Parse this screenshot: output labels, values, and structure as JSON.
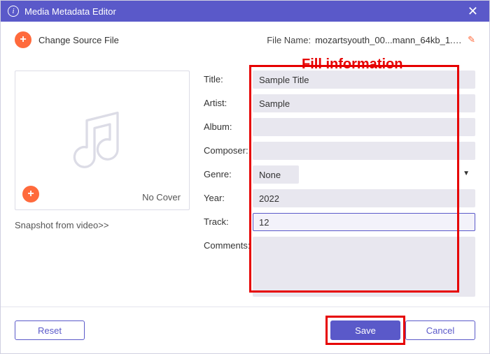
{
  "window": {
    "title": "Media Metadata Editor"
  },
  "toolbar": {
    "change_source": "Change Source File",
    "file_name_label": "File Name:",
    "file_name_value": "mozartsyouth_00...mann_64kb_1.wav"
  },
  "annotation": {
    "fill_info": "Fill information"
  },
  "form": {
    "labels": {
      "title": "Title:",
      "artist": "Artist:",
      "album": "Album:",
      "composer": "Composer:",
      "genre": "Genre:",
      "year": "Year:",
      "track": "Track:",
      "comments": "Comments:"
    },
    "values": {
      "title": "Sample Title",
      "artist": "Sample",
      "album": "",
      "composer": "",
      "genre": "None",
      "year": "2022",
      "track": "12",
      "comments": ""
    }
  },
  "cover": {
    "no_cover": "No Cover",
    "snapshot": "Snapshot from video>>"
  },
  "buttons": {
    "reset": "Reset",
    "save": "Save",
    "cancel": "Cancel"
  }
}
